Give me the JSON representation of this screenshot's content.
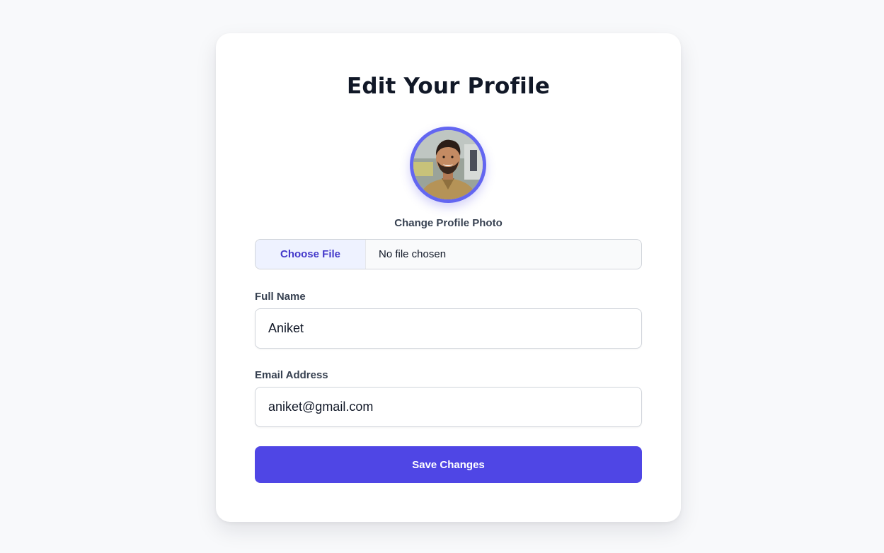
{
  "page": {
    "title": "Edit Your Profile"
  },
  "avatar": {
    "photo_label": "Change Profile Photo",
    "ring_color": "#6366f1"
  },
  "file_input": {
    "button_label": "Choose File",
    "status": "No file chosen"
  },
  "form": {
    "full_name": {
      "label": "Full Name",
      "value": "Aniket"
    },
    "email": {
      "label": "Email Address",
      "value": "aniket@gmail.com"
    }
  },
  "actions": {
    "save_label": "Save Changes",
    "accent_color": "#4f46e5"
  }
}
